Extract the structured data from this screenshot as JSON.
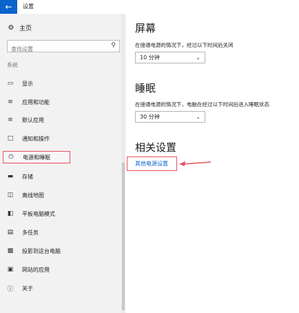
{
  "titlebar": {
    "title": "设置",
    "back_icon": "back-arrow-icon"
  },
  "sidebar": {
    "home_label": "主页",
    "search_placeholder": "查找设置",
    "section_label": "系统",
    "items": [
      {
        "label": "显示",
        "icon": "display-icon"
      },
      {
        "label": "应用和功能",
        "icon": "apps-features-icon"
      },
      {
        "label": "默认应用",
        "icon": "default-apps-icon"
      },
      {
        "label": "通知和操作",
        "icon": "notifications-icon"
      },
      {
        "label": "电源和睡眠",
        "icon": "power-icon",
        "selected": true
      },
      {
        "label": "存储",
        "icon": "storage-icon"
      },
      {
        "label": "离线地图",
        "icon": "offline-maps-icon"
      },
      {
        "label": "平板电脑模式",
        "icon": "tablet-mode-icon"
      },
      {
        "label": "多任务",
        "icon": "multitasking-icon"
      },
      {
        "label": "投影到这台电脑",
        "icon": "project-icon"
      },
      {
        "label": "网站的应用",
        "icon": "web-apps-icon"
      },
      {
        "label": "关于",
        "icon": "about-icon"
      }
    ]
  },
  "main": {
    "screen": {
      "heading": "屏幕",
      "description": "在接通电源的情况下，经过以下时间后关闭",
      "value": "10 分钟"
    },
    "sleep": {
      "heading": "睡眠",
      "description": "在接通电源的情况下，电脑在经过以下时间后进入睡眠状态",
      "value": "30 分钟"
    },
    "related": {
      "heading": "相关设置",
      "link_label": "其他电源设置"
    }
  },
  "colors": {
    "accent": "#0b63ce",
    "highlight": "#e8505b",
    "sidebar_bg": "#f2f2f2"
  }
}
